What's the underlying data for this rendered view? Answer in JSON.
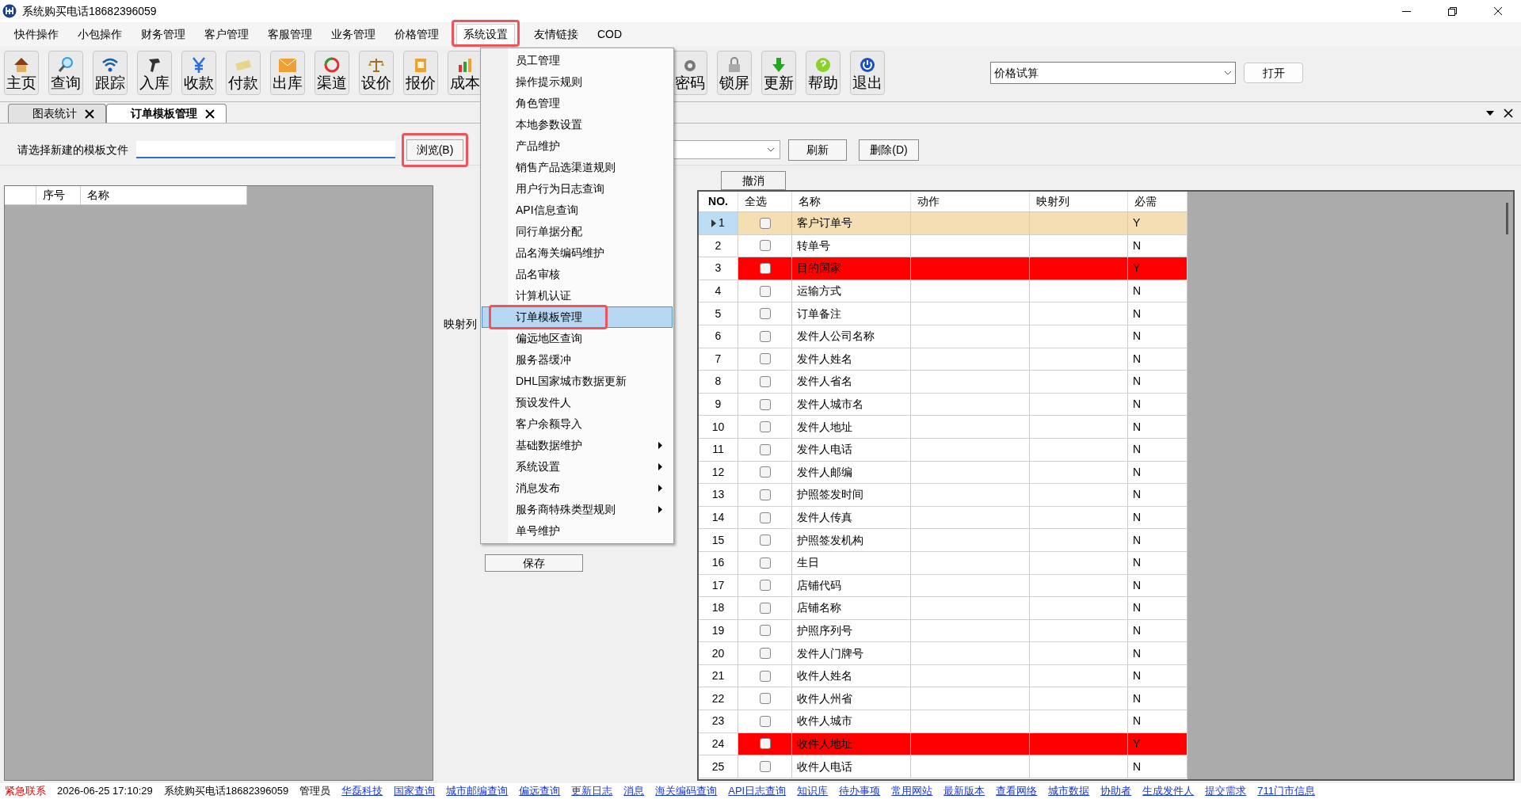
{
  "window": {
    "title": "系统购买电话18682396059"
  },
  "menu_bar": [
    {
      "label": "快件操作",
      "selected": false
    },
    {
      "label": "小包操作",
      "selected": false
    },
    {
      "label": "财务管理",
      "selected": false
    },
    {
      "label": "客户管理",
      "selected": false
    },
    {
      "label": "客服管理",
      "selected": false
    },
    {
      "label": "业务管理",
      "selected": false
    },
    {
      "label": "价格管理",
      "selected": false
    },
    {
      "label": "系统设置",
      "selected": true
    },
    {
      "label": "友情链接",
      "selected": false
    },
    {
      "label": "COD",
      "selected": false
    }
  ],
  "toolbar": {
    "left": [
      "主页",
      "查询",
      "跟踪",
      "入库",
      "收款",
      "付款",
      "出库",
      "渠道",
      "设价",
      "报价",
      "成本"
    ],
    "right": [
      "密码",
      "锁屏",
      "更新",
      "帮助",
      "退出"
    ]
  },
  "quick_open": {
    "value": "价格试算",
    "button": "打开"
  },
  "tabs": [
    {
      "label": "图表统计",
      "selected": false
    },
    {
      "label": "订单模板管理",
      "selected": true
    }
  ],
  "template_form": {
    "label": "请选择新建的模板文件",
    "browse_button": "浏览(B)",
    "refresh_button": "刷新",
    "delete_button": "删除(D)",
    "cancel_button": "撤消",
    "mapping_label": "映射列",
    "save_button": "保存"
  },
  "left_grid": {
    "columns": [
      "序号",
      "名称"
    ]
  },
  "grid": {
    "columns": [
      "NO.",
      "全选",
      "名称",
      "动作",
      "映射列",
      "必需"
    ],
    "rows": [
      {
        "no": "1",
        "checked": false,
        "name": "客户订单号",
        "required": "Y",
        "selected": true
      },
      {
        "no": "2",
        "checked": false,
        "name": "转单号",
        "required": "N",
        "selected": false
      },
      {
        "no": "3",
        "checked": false,
        "name": "目的国家",
        "required": "Y",
        "selected": false,
        "color": "#ff0000"
      },
      {
        "no": "4",
        "checked": false,
        "name": "运输方式",
        "required": "N",
        "selected": false
      },
      {
        "no": "5",
        "checked": false,
        "name": "订单备注",
        "required": "N",
        "selected": false
      },
      {
        "no": "6",
        "checked": false,
        "name": "发件人公司名称",
        "required": "N",
        "selected": false
      },
      {
        "no": "7",
        "checked": false,
        "name": "发件人姓名",
        "required": "N",
        "selected": false
      },
      {
        "no": "8",
        "checked": false,
        "name": "发件人省名",
        "required": "N",
        "selected": false
      },
      {
        "no": "9",
        "checked": false,
        "name": "发件人城市名",
        "required": "N",
        "selected": false
      },
      {
        "no": "10",
        "checked": false,
        "name": "发件人地址",
        "required": "N",
        "selected": false
      },
      {
        "no": "11",
        "checked": false,
        "name": "发件人电话",
        "required": "N",
        "selected": false
      },
      {
        "no": "12",
        "checked": false,
        "name": "发件人邮编",
        "required": "N",
        "selected": false
      },
      {
        "no": "13",
        "checked": false,
        "name": "护照签发时间",
        "required": "N",
        "selected": false
      },
      {
        "no": "14",
        "checked": false,
        "name": "发件人传真",
        "required": "N",
        "selected": false
      },
      {
        "no": "15",
        "checked": false,
        "name": "护照签发机构",
        "required": "N",
        "selected": false
      },
      {
        "no": "16",
        "checked": false,
        "name": "生日",
        "required": "N",
        "selected": false
      },
      {
        "no": "17",
        "checked": false,
        "name": "店铺代码",
        "required": "N",
        "selected": false
      },
      {
        "no": "18",
        "checked": false,
        "name": "店铺名称",
        "required": "N",
        "selected": false
      },
      {
        "no": "19",
        "checked": false,
        "name": "护照序列号",
        "required": "N",
        "selected": false
      },
      {
        "no": "20",
        "checked": false,
        "name": "发件人门牌号",
        "required": "N",
        "selected": false
      },
      {
        "no": "21",
        "checked": false,
        "name": "收件人姓名",
        "required": "N",
        "selected": false
      },
      {
        "no": "22",
        "checked": false,
        "name": "收件人州省",
        "required": "N",
        "selected": false
      },
      {
        "no": "23",
        "checked": false,
        "name": "收件人城市",
        "required": "N",
        "selected": false
      },
      {
        "no": "24",
        "checked": false,
        "name": "收件人地址",
        "required": "Y",
        "selected": false,
        "color": "#ff0000"
      },
      {
        "no": "25",
        "checked": false,
        "name": "收件人电话",
        "required": "N",
        "selected": false
      }
    ]
  },
  "dropdown_menu": {
    "items": [
      {
        "label": "员工管理",
        "selected": false,
        "submenu": false
      },
      {
        "label": "操作提示规则",
        "selected": false,
        "submenu": false
      },
      {
        "label": "角色管理",
        "selected": false,
        "submenu": false
      },
      {
        "label": "本地参数设置",
        "selected": false,
        "submenu": false
      },
      {
        "label": "产品维护",
        "selected": false,
        "submenu": false
      },
      {
        "label": "销售产品选渠道规则",
        "selected": false,
        "submenu": false
      },
      {
        "label": "用户行为日志查询",
        "selected": false,
        "submenu": false
      },
      {
        "label": "API信息查询",
        "selected": false,
        "submenu": false
      },
      {
        "label": "同行单据分配",
        "selected": false,
        "submenu": false
      },
      {
        "label": "品名海关编码维护",
        "selected": false,
        "submenu": false
      },
      {
        "label": "品名审核",
        "selected": false,
        "submenu": false
      },
      {
        "label": "计算机认证",
        "selected": false,
        "submenu": false
      },
      {
        "label": "订单模板管理",
        "selected": true,
        "submenu": false
      },
      {
        "label": "偏远地区查询",
        "selected": false,
        "submenu": false
      },
      {
        "label": "服务器缓冲",
        "selected": false,
        "submenu": false
      },
      {
        "label": "DHL国家城市数据更新",
        "selected": false,
        "submenu": false
      },
      {
        "label": "预设发件人",
        "selected": false,
        "submenu": false
      },
      {
        "label": "客户余额导入",
        "selected": false,
        "submenu": false
      },
      {
        "label": "基础数据维护",
        "selected": false,
        "submenu": true
      },
      {
        "label": "系统设置",
        "selected": false,
        "submenu": true
      },
      {
        "label": "消息发布",
        "selected": false,
        "submenu": true
      },
      {
        "label": "服务商特殊类型规则",
        "selected": false,
        "submenu": true
      },
      {
        "label": "单号维护",
        "selected": false,
        "submenu": false
      }
    ]
  },
  "status_bar": {
    "alert": "紧急联系",
    "time": "2026-06-25 17:10:29",
    "phone": "系统购买电话18682396059",
    "user": "管理员",
    "links": [
      "华磊科技",
      "国家查询",
      "城市邮编查询",
      "偏远查询",
      "更新日志",
      "消息",
      "海关编码查询",
      "API日志查询",
      "知识库",
      "待办事项",
      "常用网站",
      "最新版本",
      "查看网络",
      "城市数据",
      "协助者",
      "生成发件人",
      "提交需求",
      "711门市信息"
    ]
  }
}
